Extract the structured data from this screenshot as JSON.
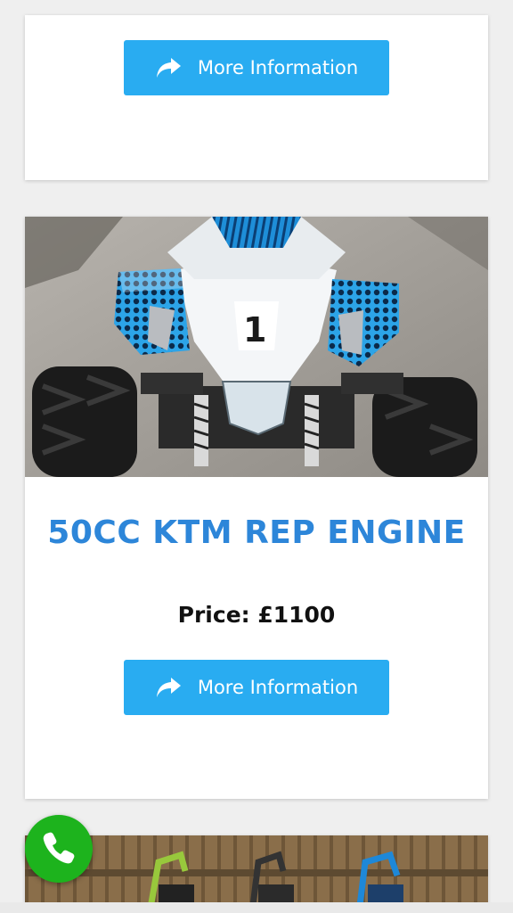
{
  "cards": {
    "previous": {
      "button_label": "More Information"
    },
    "product": {
      "title": "50CC KTM REP ENGINE",
      "price": "Price: £1100",
      "button_label": "More Information"
    }
  },
  "icons": {
    "share": "share-arrow-icon",
    "phone": "phone-icon"
  },
  "colors": {
    "accent_button": "#29acf1",
    "title_blue": "#2d86d9",
    "call_green": "#1db31d"
  }
}
